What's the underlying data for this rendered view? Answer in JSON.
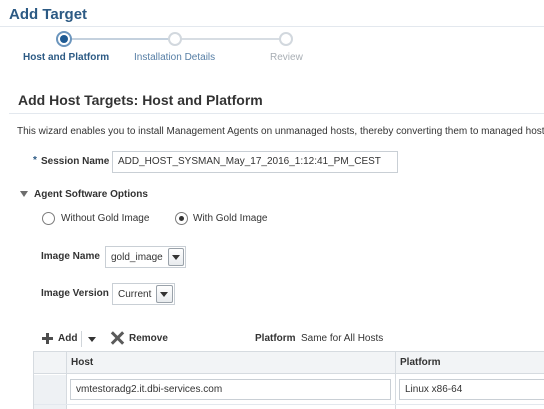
{
  "page": {
    "title": "Add Target"
  },
  "train": {
    "steps": [
      {
        "label": "Host and Platform",
        "state": "current"
      },
      {
        "label": "Installation Details",
        "state": "upcoming"
      },
      {
        "label": "Review",
        "state": "disabled"
      }
    ]
  },
  "section": {
    "title": "Add Host Targets: Host and Platform",
    "description": "This wizard enables you to install Management Agents on unmanaged hosts, thereby converting them to managed hosts."
  },
  "session": {
    "required_marker": "*",
    "label": "Session Name",
    "value": "ADD_HOST_SYSMAN_May_17_2016_1:12:41_PM_CEST"
  },
  "agent_options": {
    "title": "Agent Software Options",
    "radio_without": "Without Gold Image",
    "radio_with": "With Gold Image",
    "selected": "With Gold Image",
    "image_name_label": "Image Name",
    "image_name_value": "gold_image",
    "image_version_label": "Image Version",
    "image_version_value": "Current"
  },
  "toolbar": {
    "add_label": "Add",
    "remove_label": "Remove",
    "platform_label": "Platform",
    "platform_value": "Same for All Hosts"
  },
  "table": {
    "columns": [
      "Host",
      "Platform"
    ],
    "rows": [
      {
        "host": "vmtestoradg2.it.dbi-services.com",
        "platform": "Linux x86-64"
      }
    ]
  },
  "colors": {
    "title_blue": "#2c5a84",
    "train_active": "#1e5a93",
    "link_blue": "#567ea5"
  },
  "icons": [
    "plus-icon",
    "chevron-down-icon",
    "remove-x-icon",
    "collapse-triangle-icon"
  ]
}
